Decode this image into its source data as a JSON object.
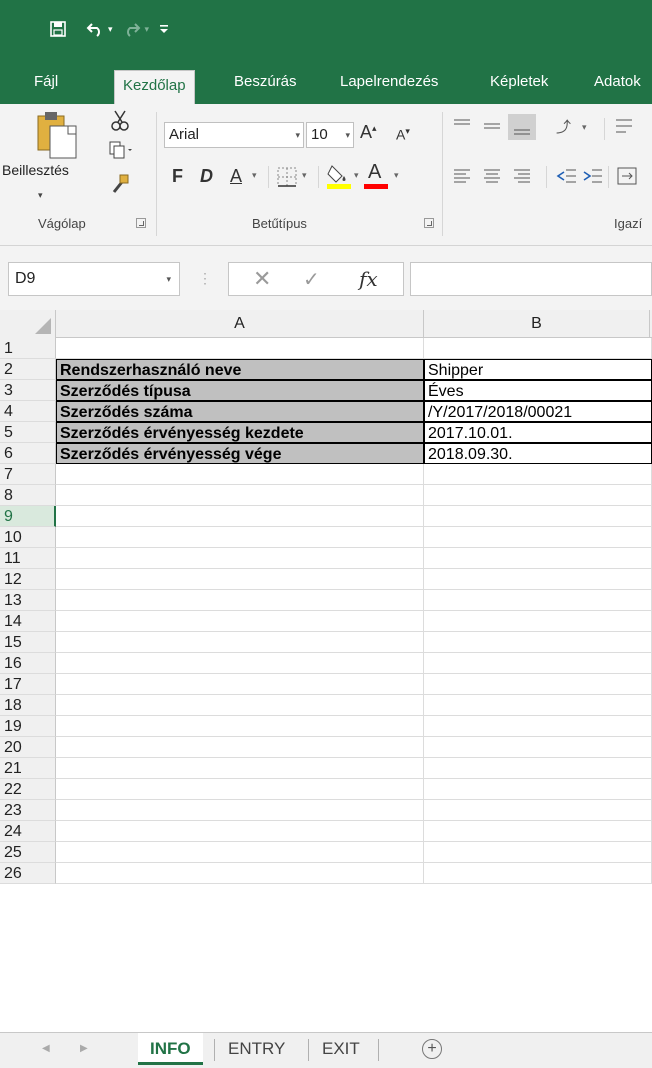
{
  "quick_access": {
    "icons": [
      "save-icon",
      "undo-icon",
      "redo-icon",
      "customize-icon"
    ]
  },
  "ribbon_tabs": [
    "Fájl",
    "Kezdőlap",
    "Beszúrás",
    "Lapelrendezés",
    "Képletek",
    "Adatok"
  ],
  "active_tab": "Kezdőlap",
  "ribbon": {
    "paste_label": "Beillesztés",
    "group_clipboard": "Vágólap",
    "group_font": "Betűtípus",
    "group_alignment": "Igazí",
    "font_name": "Arial",
    "font_size": "10",
    "bold_label": "F",
    "italic_label": "D",
    "underline_label": "A",
    "grow_font": "A",
    "shrink_font": "A",
    "font_color_label": "A",
    "fill_color": "#ffff00",
    "font_color": "#ff0000"
  },
  "formula_bar": {
    "name_box": "D9",
    "fx_label": "fx",
    "formula": ""
  },
  "columns": [
    "A",
    "B"
  ],
  "rows": [
    {
      "num": "1",
      "a": "",
      "b": ""
    },
    {
      "num": "2",
      "a": "Rendszerhasználó neve",
      "b": "Shipper"
    },
    {
      "num": "3",
      "a": "Szerződés típusa",
      "b": "Éves"
    },
    {
      "num": "4",
      "a": "Szerződés száma",
      "b": "/Y/2017/2018/00021"
    },
    {
      "num": "5",
      "a": "Szerződés érvényesség kezdete",
      "b": "2017.10.01."
    },
    {
      "num": "6",
      "a": "Szerződés érvényesség vége",
      "b": "2018.09.30."
    },
    {
      "num": "7",
      "a": "",
      "b": ""
    },
    {
      "num": "8",
      "a": "",
      "b": ""
    },
    {
      "num": "9",
      "a": "",
      "b": ""
    },
    {
      "num": "10",
      "a": "",
      "b": ""
    },
    {
      "num": "11",
      "a": "",
      "b": ""
    },
    {
      "num": "12",
      "a": "",
      "b": ""
    },
    {
      "num": "13",
      "a": "",
      "b": ""
    },
    {
      "num": "14",
      "a": "",
      "b": ""
    },
    {
      "num": "15",
      "a": "",
      "b": ""
    },
    {
      "num": "16",
      "a": "",
      "b": ""
    },
    {
      "num": "17",
      "a": "",
      "b": ""
    },
    {
      "num": "18",
      "a": "",
      "b": ""
    },
    {
      "num": "19",
      "a": "",
      "b": ""
    },
    {
      "num": "20",
      "a": "",
      "b": ""
    },
    {
      "num": "21",
      "a": "",
      "b": ""
    },
    {
      "num": "22",
      "a": "",
      "b": ""
    },
    {
      "num": "23",
      "a": "",
      "b": ""
    },
    {
      "num": "24",
      "a": "",
      "b": ""
    },
    {
      "num": "25",
      "a": "",
      "b": ""
    },
    {
      "num": "26",
      "a": "",
      "b": ""
    }
  ],
  "active_row": "9",
  "sheet_tabs": [
    "INFO",
    "ENTRY",
    "EXIT"
  ],
  "active_sheet": "INFO",
  "colors": {
    "accent": "#217346",
    "label_fill": "#c0c0c0"
  }
}
